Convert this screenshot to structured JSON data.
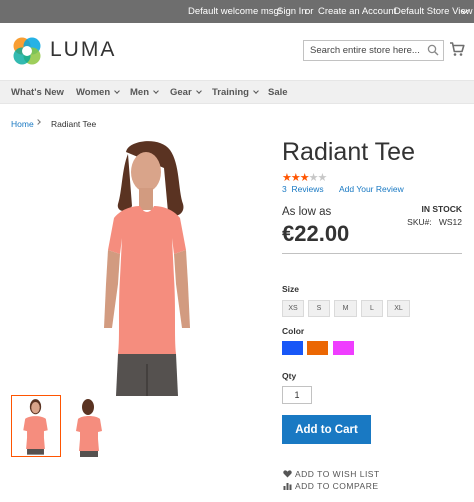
{
  "topbar": {
    "welcome": "Default welcome msg!",
    "sign_in": "Sign In",
    "or": "or",
    "create_account": "Create an Account",
    "store_view": "Default Store View"
  },
  "header": {
    "logo_text": "LUMA",
    "search_placeholder": "Search entire store here..."
  },
  "nav": {
    "items": [
      {
        "label": "What's New"
      },
      {
        "label": "Women"
      },
      {
        "label": "Men"
      },
      {
        "label": "Gear"
      },
      {
        "label": "Training"
      },
      {
        "label": "Sale"
      }
    ]
  },
  "breadcrumb": {
    "home": "Home",
    "current": "Radiant Tee"
  },
  "product": {
    "title": "Radiant Tee",
    "rating_stars": 3,
    "rating_max": 5,
    "reviews_count": "3",
    "reviews_label": "Reviews",
    "add_review": "Add Your Review",
    "as_low_as": "As low as",
    "price": "€22.00",
    "stock": "IN STOCK",
    "sku_label": "SKU#:",
    "sku": "WS12",
    "size_label": "Size",
    "sizes": [
      "XS",
      "S",
      "M",
      "L",
      "XL"
    ],
    "color_label": "Color",
    "colors": [
      "#1857f7",
      "#eb6703",
      "#ef3dff"
    ],
    "qty_label": "Qty",
    "qty_value": "1",
    "add_to_cart": "Add to Cart",
    "wishlist": "ADD TO WISH LIST",
    "compare": "ADD TO COMPARE"
  },
  "colors": {
    "accent": "#1979c3",
    "brand_orange": "#ff5501",
    "topbar_bg": "#6e6e6e"
  }
}
